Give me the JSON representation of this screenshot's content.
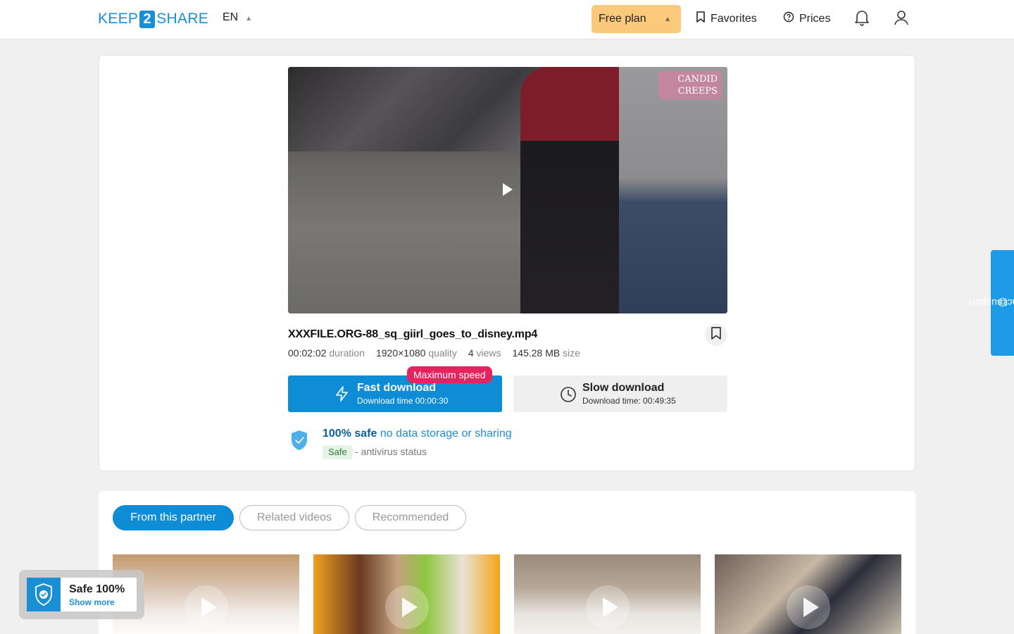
{
  "header": {
    "logo_left": "KEEP",
    "logo_num": "2",
    "logo_right": "SHARE",
    "language": "EN",
    "plan_label": "Free plan",
    "favorites_label": "Favorites",
    "prices_label": "Prices"
  },
  "video": {
    "watermark": "CANDID CREEPS",
    "title": "XXXFILE.ORG-88_sq_giirl_goes_to_disney.mp4",
    "duration_value": "00:02:02",
    "duration_label": "duration",
    "quality_value": "1920×1080",
    "quality_label": "quality",
    "views_value": "4",
    "views_label": "views",
    "size_value": "145.28 MB",
    "size_label": "size"
  },
  "download": {
    "badge": "Maximum speed",
    "fast_label": "Fast download",
    "fast_time": "Download time 00:00:30",
    "slow_label": "Slow download",
    "slow_time": "Download time: 00:49:35"
  },
  "safety": {
    "headline": "100% safe",
    "subline": " no data storage or sharing",
    "tag": "Safe",
    "antivirus": "- antivirus status"
  },
  "tabs": [
    {
      "label": "From this partner",
      "active": true
    },
    {
      "label": "Related videos",
      "active": false
    },
    {
      "label": "Recommended",
      "active": false
    }
  ],
  "safe_badge": {
    "title": "Safe 100%",
    "link": "Show more"
  },
  "support": {
    "label": "contact support"
  },
  "colors": {
    "accent": "#0f8cd6",
    "plan": "#fbc97a",
    "badge": "#e5235e",
    "safe_tag_bg": "#e4f5e6"
  }
}
